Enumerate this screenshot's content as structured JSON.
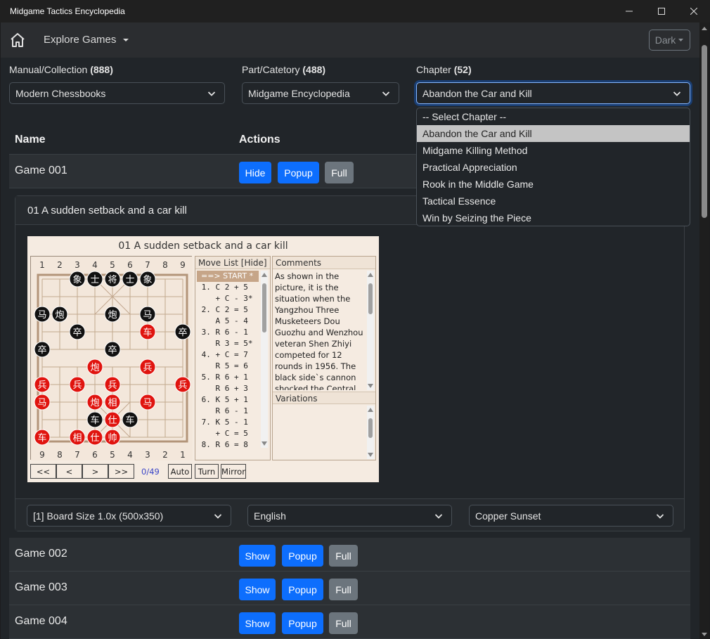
{
  "window": {
    "title": "Midgame Tactics Encyclopedia"
  },
  "navbar": {
    "explore_label": "Explore Games",
    "theme_label": "Dark"
  },
  "filters": {
    "collection": {
      "label": "Manual/Collection",
      "count": "(888)",
      "value": "Modern Chessbooks"
    },
    "part": {
      "label": "Part/Catetory",
      "count": "(488)",
      "value": "Midgame Encyclopedia"
    },
    "chapter": {
      "label": "Chapter",
      "count": "(52)",
      "value": "Abandon the Car and Kill",
      "options": [
        "-- Select Chapter --",
        "Abandon the Car and Kill",
        "Midgame Killing Method",
        "Practical Appreciation",
        "Rook in the Middle Game",
        "Tactical Essence",
        "Win by Seizing the Piece"
      ]
    }
  },
  "table": {
    "col_name": "Name",
    "col_actions": "Actions"
  },
  "games": [
    {
      "name": "Game 001",
      "toggle": "Hide",
      "popup": "Popup",
      "full": "Full"
    },
    {
      "name": "Game 002",
      "toggle": "Show",
      "popup": "Popup",
      "full": "Full"
    },
    {
      "name": "Game 003",
      "toggle": "Show",
      "popup": "Popup",
      "full": "Full"
    },
    {
      "name": "Game 004",
      "toggle": "Show",
      "popup": "Popup",
      "full": "Full"
    }
  ],
  "expanded": {
    "title": "01 A sudden setback and a car kill",
    "viewer": {
      "title": "01 A sudden setback and a car kill",
      "files_top": [
        "1",
        "2",
        "3",
        "4",
        "5",
        "6",
        "7",
        "8",
        "9"
      ],
      "files_bottom": [
        "9",
        "8",
        "7",
        "6",
        "5",
        "4",
        "3",
        "2",
        "1"
      ],
      "pieces": [
        {
          "c": 2,
          "r": 0,
          "ch": "象",
          "s": "b"
        },
        {
          "c": 3,
          "r": 0,
          "ch": "士",
          "s": "b"
        },
        {
          "c": 4,
          "r": 0,
          "ch": "将",
          "s": "b"
        },
        {
          "c": 5,
          "r": 0,
          "ch": "士",
          "s": "b"
        },
        {
          "c": 6,
          "r": 0,
          "ch": "象",
          "s": "b"
        },
        {
          "c": 0,
          "r": 2,
          "ch": "马",
          "s": "b"
        },
        {
          "c": 1,
          "r": 2,
          "ch": "炮",
          "s": "b"
        },
        {
          "c": 4,
          "r": 2,
          "ch": "炮",
          "s": "b"
        },
        {
          "c": 6,
          "r": 2,
          "ch": "马",
          "s": "b"
        },
        {
          "c": 2,
          "r": 3,
          "ch": "卒",
          "s": "b"
        },
        {
          "c": 6,
          "r": 3,
          "ch": "车",
          "s": "r"
        },
        {
          "c": 8,
          "r": 3,
          "ch": "卒",
          "s": "b"
        },
        {
          "c": 0,
          "r": 4,
          "ch": "卒",
          "s": "b"
        },
        {
          "c": 4,
          "r": 4,
          "ch": "卒",
          "s": "b"
        },
        {
          "c": 3,
          "r": 5,
          "ch": "炮",
          "s": "r"
        },
        {
          "c": 6,
          "r": 5,
          "ch": "兵",
          "s": "r"
        },
        {
          "c": 0,
          "r": 6,
          "ch": "兵",
          "s": "r"
        },
        {
          "c": 2,
          "r": 6,
          "ch": "兵",
          "s": "r"
        },
        {
          "c": 4,
          "r": 6,
          "ch": "兵",
          "s": "r"
        },
        {
          "c": 8,
          "r": 6,
          "ch": "兵",
          "s": "r"
        },
        {
          "c": 0,
          "r": 7,
          "ch": "马",
          "s": "r"
        },
        {
          "c": 3,
          "r": 7,
          "ch": "炮",
          "s": "r"
        },
        {
          "c": 4,
          "r": 7,
          "ch": "相",
          "s": "r"
        },
        {
          "c": 6,
          "r": 7,
          "ch": "马",
          "s": "r"
        },
        {
          "c": 3,
          "r": 8,
          "ch": "车",
          "s": "b"
        },
        {
          "c": 4,
          "r": 8,
          "ch": "仕",
          "s": "r"
        },
        {
          "c": 5,
          "r": 8,
          "ch": "车",
          "s": "b"
        },
        {
          "c": 0,
          "r": 9,
          "ch": "车",
          "s": "r"
        },
        {
          "c": 2,
          "r": 9,
          "ch": "相",
          "s": "r"
        },
        {
          "c": 3,
          "r": 9,
          "ch": "仕",
          "s": "r"
        },
        {
          "c": 4,
          "r": 9,
          "ch": "帅",
          "s": "r"
        }
      ],
      "move_list_label": "Move List [Hide]",
      "moves": [
        "==> START *",
        "1. C 2 + 5",
        "   + C - 3*",
        "2. C 2 = 5",
        "   A 5 - 4",
        "3. R 6 - 1",
        "   R 3 = 5*",
        "4. + C = 7",
        "   R 5 = 6",
        "5. R 6 + 1",
        "   R 6 + 3",
        "6. K 5 + 1",
        "   R 6 - 1",
        "7. K 5 - 1",
        "   + C = 5",
        "8. R 6 = 8"
      ],
      "comments_label": "Comments",
      "comment": "As shown in the picture, it is the situation when the Yangzhou Three Musketeers Dou Guozhu and Wenzhou veteran Shen Zhiyi competed for 12 rounds in 1956. The black side`s cannon shocked the Central Plains, `two ghosts",
      "variations_label": "Variations",
      "nav": {
        "first": "<<",
        "prev": "<",
        "next": ">",
        "last": ">>",
        "counter": "0/49",
        "auto": "Auto",
        "turn": "Turn",
        "mirror": "Mirror"
      }
    },
    "board_size": "[1] Board Size 1.0x (500x350)",
    "language": "English",
    "theme": "Copper Sunset"
  },
  "colors": {
    "primary": "#0d6efd",
    "secondary": "#6c757d",
    "red_piece": "#e0140f",
    "black_piece": "#111111"
  }
}
